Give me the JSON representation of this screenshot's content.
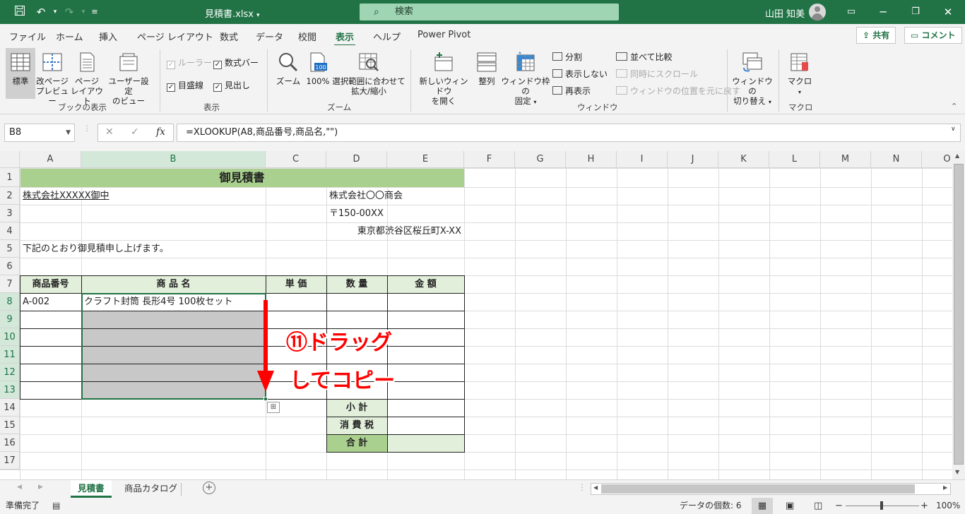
{
  "title_bar": {
    "file_title": "見積書.xlsx",
    "search_placeholder": "検索",
    "user_name": "山田 知美"
  },
  "menu_tabs": [
    "ファイル",
    "ホーム",
    "挿入",
    "ページ レイアウト",
    "数式",
    "データ",
    "校閲",
    "表示",
    "ヘルプ",
    "Power Pivot"
  ],
  "active_tab": "表示",
  "share_label": "共有",
  "comment_label": "コメント",
  "ribbon": {
    "book_view": {
      "group_label": "ブックの表示",
      "normal": "標準",
      "page_break_1": "改ページ",
      "page_break_2": "プレビュー",
      "page_layout_1": "ページ",
      "page_layout_2": "レイアウト",
      "custom_1": "ユーザー設定",
      "custom_2": "のビュー"
    },
    "show": {
      "group_label": "表示",
      "ruler": "ルーラー",
      "formula_bar": "数式バー",
      "gridlines": "目盛線",
      "headings": "見出し"
    },
    "zoom": {
      "group_label": "ズーム",
      "zoom": "ズーム",
      "hundred": "100%",
      "hundred_icon": "100",
      "fit_1": "選択範囲に合わせて",
      "fit_2": "拡大/縮小"
    },
    "window": {
      "group_label": "ウィンドウ",
      "new_window_1": "新しいウィンドウ",
      "new_window_2": "を開く",
      "arrange": "整列",
      "freeze_1": "ウィンドウ枠の",
      "freeze_2": "固定",
      "split": "分割",
      "hide": "表示しない",
      "unhide": "再表示",
      "side_by_side": "並べて比較",
      "sync_scroll": "同時にスクロール",
      "reset_position": "ウィンドウの位置を元に戻す",
      "switch_1": "ウィンドウの",
      "switch_2": "切り替え"
    },
    "macro": {
      "group_label": "マクロ",
      "macro": "マクロ"
    }
  },
  "formula_bar": {
    "name_box": "B8",
    "formula": "=XLOOKUP(A8,商品番号,商品名,\"\")"
  },
  "columns": [
    "A",
    "B",
    "C",
    "D",
    "E",
    "F",
    "G",
    "H",
    "I",
    "J",
    "K",
    "L",
    "M",
    "N",
    "O"
  ],
  "rows": [
    "1",
    "2",
    "3",
    "4",
    "5",
    "6",
    "7",
    "8",
    "9",
    "10",
    "11",
    "12",
    "13",
    "14",
    "15",
    "16",
    "17"
  ],
  "sheet": {
    "title": "御見積書",
    "customer": "株式会社XXXXX御中",
    "company": "株式会社〇〇商会",
    "postal": "〒150-00XX",
    "address": "東京都渋谷区桜丘町X-XX",
    "message": "下記のとおり御見積申し上げます。",
    "headers": [
      "商品番号",
      "商 品 名",
      "単 価",
      "数 量",
      "金 額"
    ],
    "row8": {
      "code": "A-002",
      "name": "クラフト封筒 長形4号 100枚セット"
    },
    "subtotal": "小 計",
    "tax": "消 費 税",
    "total": "合 計"
  },
  "annotation": {
    "line1": "⑪ドラッグ",
    "line2": "してコピー"
  },
  "sheet_tabs": [
    "見積書",
    "商品カタログ"
  ],
  "active_sheet": "見積書",
  "status": {
    "ready": "準備完了",
    "count": "データの個数: 6",
    "zoom": "100%"
  },
  "colors": {
    "accent": "#217346",
    "title_fill": "#a9d08e",
    "header_fill": "#e2efda",
    "selection_fill": "#c8c8c8",
    "annotation_red": "#ff0000"
  }
}
